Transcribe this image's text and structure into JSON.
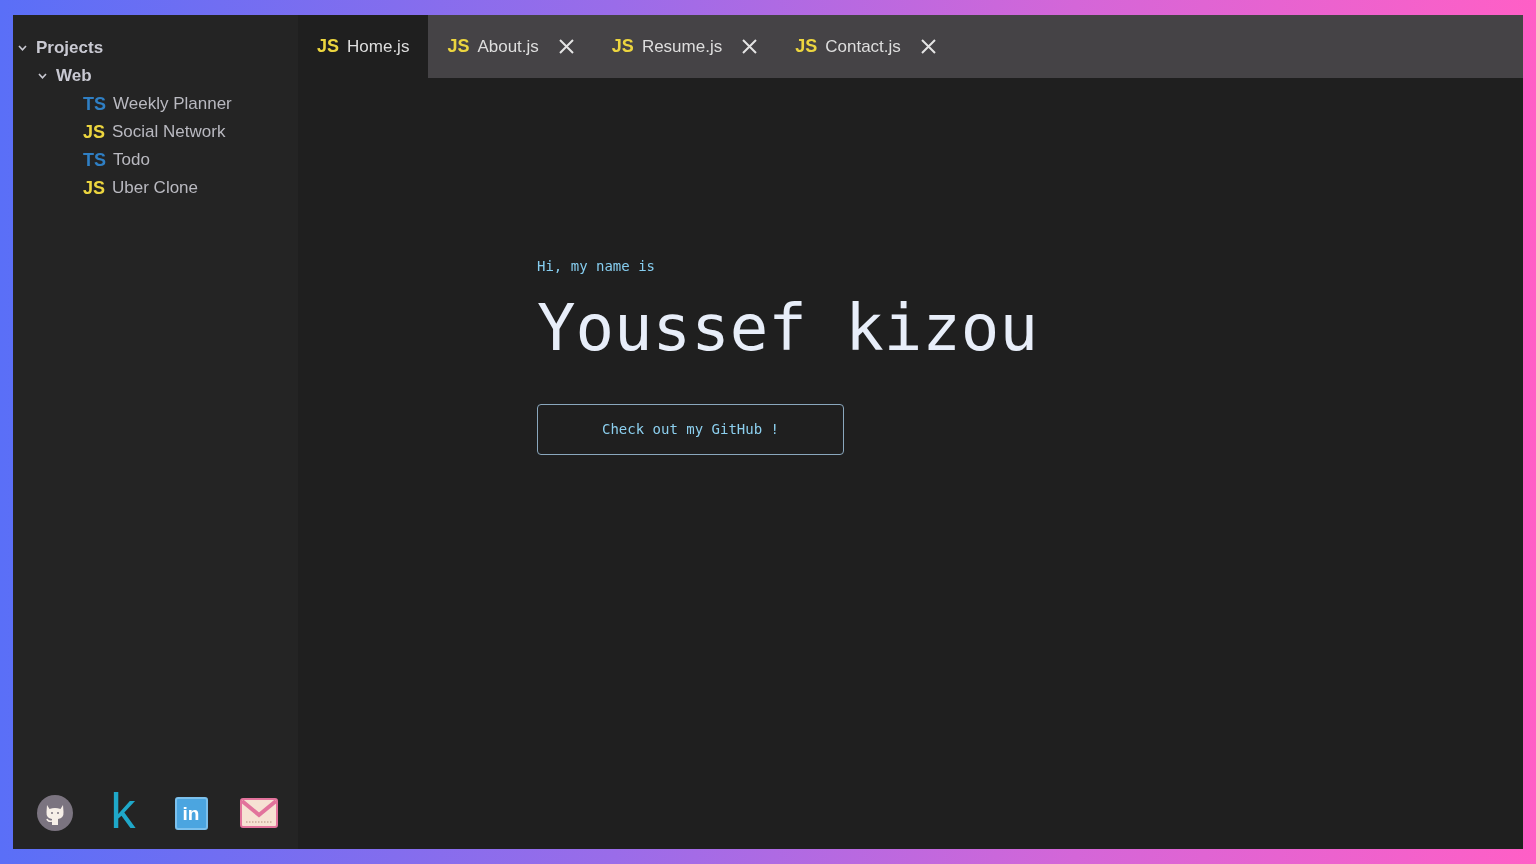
{
  "explorer": {
    "items": [
      {
        "label": "Projects",
        "expanded": true,
        "children": [
          {
            "label": "Web",
            "expanded": true,
            "children": [
              {
                "kind": "ts",
                "badge": "TS",
                "label": "Weekly Planner"
              },
              {
                "kind": "js",
                "badge": "JS",
                "label": "Social Network"
              },
              {
                "kind": "ts",
                "badge": "TS",
                "label": "Todo"
              },
              {
                "kind": "js",
                "badge": "JS",
                "label": "Uber Clone"
              }
            ]
          }
        ]
      }
    ]
  },
  "social_links": [
    {
      "kind": "cat"
    },
    {
      "kind": "letter",
      "text": "k"
    },
    {
      "kind": "tile",
      "text": "in"
    },
    {
      "kind": "envelope"
    }
  ],
  "tabs": [
    {
      "kind": "js",
      "badge": "JS",
      "label": "Home.js",
      "selected": true,
      "closable": false
    },
    {
      "kind": "js",
      "badge": "JS",
      "label": "About.js",
      "selected": false,
      "closable": true
    },
    {
      "kind": "js",
      "badge": "JS",
      "label": "Resume.js",
      "selected": false,
      "closable": true
    },
    {
      "kind": "js",
      "badge": "JS",
      "label": "Contact.js",
      "selected": false,
      "closable": true
    }
  ],
  "hero": {
    "greeting": "Hi, my name is",
    "name": "Youssef kizou",
    "button": "Check out my GitHub !"
  }
}
